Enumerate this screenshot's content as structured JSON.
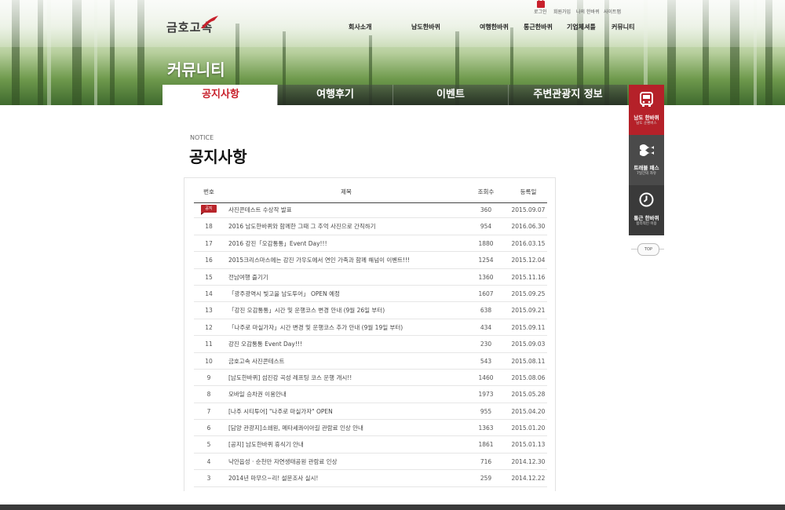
{
  "header": {
    "logo_text": "금호고속",
    "util_links": [
      "로그인",
      "회원가입",
      "나의 한바퀴",
      "사이트맵"
    ],
    "gnb": [
      "회사소개",
      "남도한바퀴",
      "여행한바퀴",
      "통근한바퀴",
      "기업체셔틀",
      "커뮤니티"
    ]
  },
  "page": {
    "heading": "커뮤니티",
    "tabs": [
      "공지사항",
      "여행후기",
      "이벤트",
      "주변관광지 정보"
    ],
    "active_tab_index": 0
  },
  "section": {
    "label_en": "NOTICE",
    "title": "공지사항"
  },
  "table": {
    "columns": [
      "번호",
      "제목",
      "조회수",
      "등록일"
    ],
    "rows": [
      {
        "no": "",
        "badge": "공지",
        "title": "사진콘테스트 수상작 발표",
        "views": "360",
        "date": "2015.09.07"
      },
      {
        "no": "18",
        "title": "2016 남도한바퀴와 함께한 그때 그 추억 사진으로 간직하기",
        "views": "954",
        "date": "2016.06.30"
      },
      {
        "no": "17",
        "title": "2016 강진「오감통통」Event Day!!!",
        "views": "1880",
        "date": "2016.03.15"
      },
      {
        "no": "16",
        "title": "2015크리스마스에는 강진 가우도에서 연인 가족과 함께 해넘이 이벤트!!!",
        "views": "1254",
        "date": "2015.12.04"
      },
      {
        "no": "15",
        "title": "전남여행 즐기기",
        "views": "1360",
        "date": "2015.11.16"
      },
      {
        "no": "14",
        "title": "「광주광역시 빛고을 남도투어」 OPEN 예정",
        "views": "1607",
        "date": "2015.09.25"
      },
      {
        "no": "13",
        "title": "「강진 오감통통」시간 및 운행코스 변경 안내 (9월 26일 부터)",
        "views": "638",
        "date": "2015.09.21"
      },
      {
        "no": "12",
        "title": "「나주로 마실가자」시간 변경 및 운행코스 추가 안내 (9월 19일 부터)",
        "views": "434",
        "date": "2015.09.11"
      },
      {
        "no": "11",
        "title": "강진 오감통통 Event Day!!!",
        "views": "230",
        "date": "2015.09.03"
      },
      {
        "no": "10",
        "title": "금호고속 사진콘테스트",
        "views": "543",
        "date": "2015.08.11"
      },
      {
        "no": "9",
        "title": "[남도한바퀴] 섬진강 곡성 레프팅 코스 운행 개시!!",
        "views": "1460",
        "date": "2015.08.06"
      },
      {
        "no": "8",
        "title": "모바일 승차권 이용안내",
        "views": "1973",
        "date": "2015.05.28"
      },
      {
        "no": "7",
        "title": "[나주 시티투어] \"나주로 마실가자\" OPEN",
        "views": "955",
        "date": "2015.04.20"
      },
      {
        "no": "6",
        "title": "[담양 관광지]소쇄원, 메타세콰이아길 관람료 인상 안내",
        "views": "1363",
        "date": "2015.01.20"
      },
      {
        "no": "5",
        "title": "[공지] 남도한바퀴 휴식기 안내",
        "views": "1861",
        "date": "2015.01.13"
      },
      {
        "no": "4",
        "title": "낙안읍성 · 순천만 자연생태공원 관람료 인상",
        "views": "716",
        "date": "2014.12.30"
      },
      {
        "no": "3",
        "title": "2014년 마무으~리! 설문조사 실시!",
        "views": "259",
        "date": "2014.12.22"
      }
    ]
  },
  "quick_menu": {
    "items": [
      {
        "label": "남도 한바퀴",
        "sub": "남도 순환버스",
        "icon": "bus-icon"
      },
      {
        "label": "트래블 패스",
        "sub": "7일간의 자유",
        "icon": "wave-icon"
      },
      {
        "label": "통근 한바퀴",
        "sub": "합리적인 이용",
        "icon": "clock-icon"
      }
    ],
    "top_label": "TOP"
  },
  "colors": {
    "accent": "#c8202b",
    "dark": "#3a3a3a"
  }
}
